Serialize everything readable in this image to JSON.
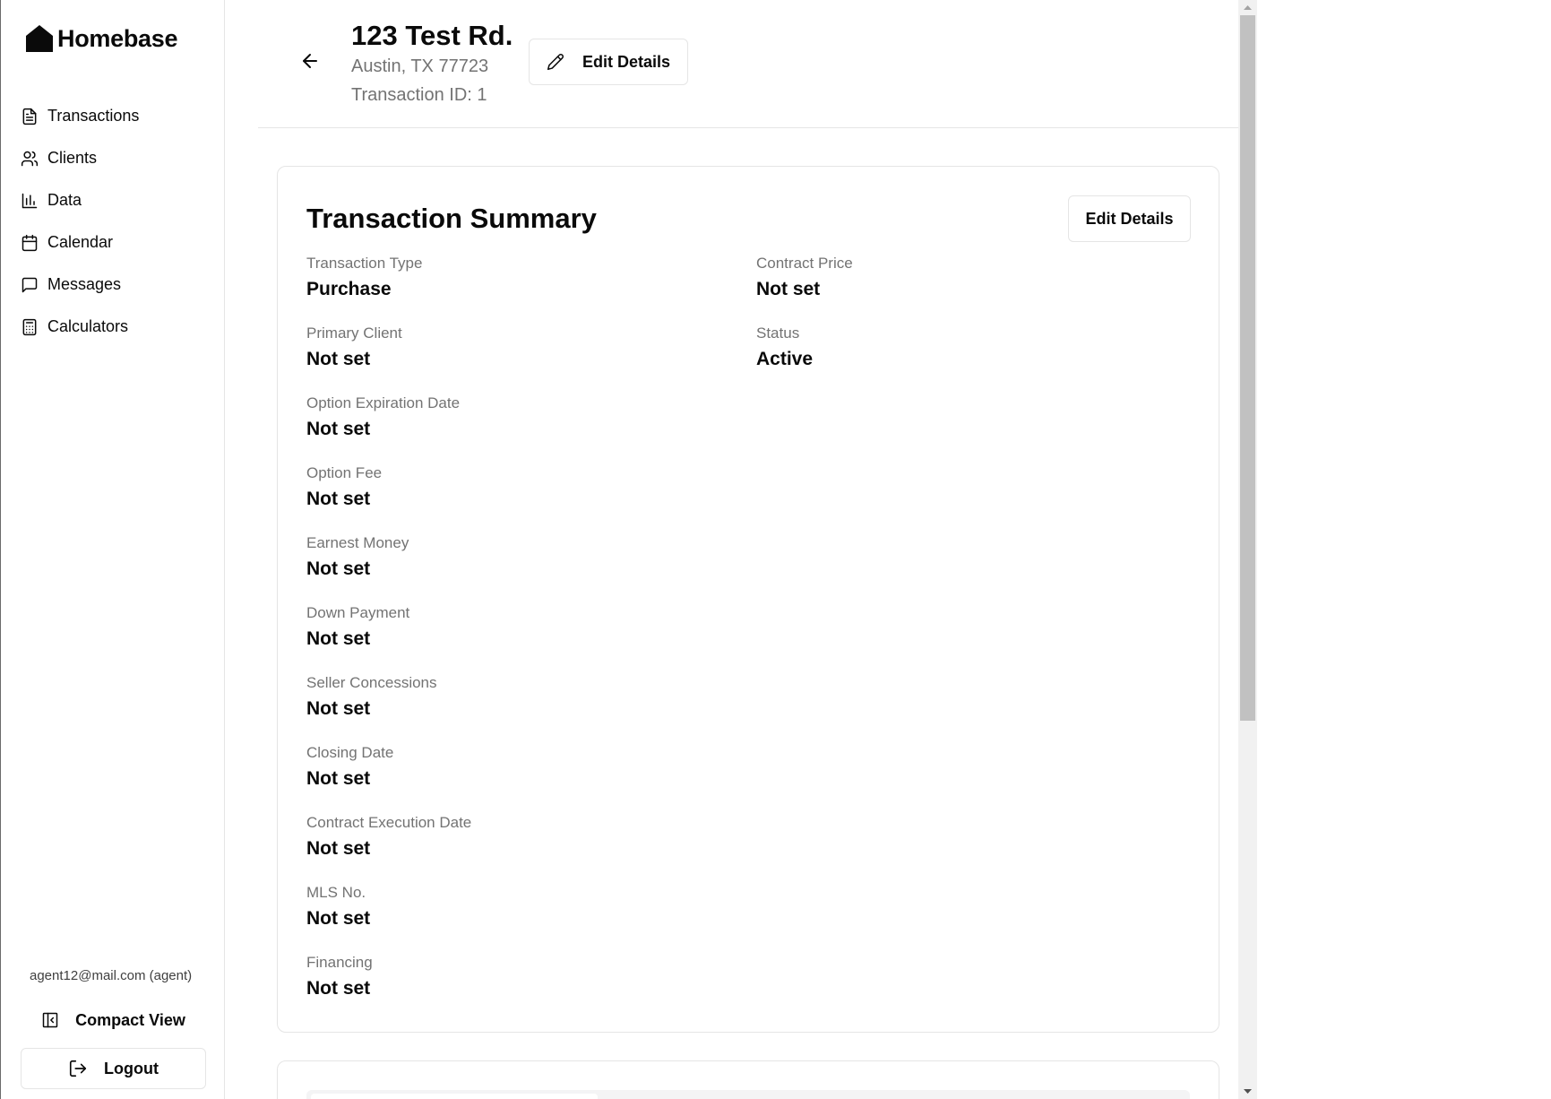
{
  "brand": {
    "name": "Homebase"
  },
  "sidebar": {
    "items": [
      {
        "label": "Transactions",
        "icon": "document-icon"
      },
      {
        "label": "Clients",
        "icon": "users-icon"
      },
      {
        "label": "Data",
        "icon": "bar-chart-icon"
      },
      {
        "label": "Calendar",
        "icon": "calendar-icon"
      },
      {
        "label": "Messages",
        "icon": "message-icon"
      },
      {
        "label": "Calculators",
        "icon": "calculator-icon"
      }
    ],
    "user_email": "agent12@mail.com (agent)",
    "compact_view_label": "Compact View",
    "logout_label": "Logout"
  },
  "header": {
    "title": "123 Test Rd.",
    "city": "Austin, TX 77723",
    "transaction_id": "Transaction ID: 1",
    "edit_label": "Edit Details"
  },
  "summary": {
    "title": "Transaction Summary",
    "edit_label": "Edit Details",
    "left_fields": [
      {
        "label": "Transaction Type",
        "value": "Purchase"
      },
      {
        "label": "Primary Client",
        "value": "Not set"
      },
      {
        "label": "Option Expiration Date",
        "value": "Not set"
      },
      {
        "label": "Option Fee",
        "value": "Not set"
      },
      {
        "label": "Earnest Money",
        "value": "Not set"
      },
      {
        "label": "Down Payment",
        "value": "Not set"
      },
      {
        "label": "Seller Concessions",
        "value": "Not set"
      },
      {
        "label": "Closing Date",
        "value": "Not set"
      },
      {
        "label": "Contract Execution Date",
        "value": "Not set"
      },
      {
        "label": "MLS No.",
        "value": "Not set"
      },
      {
        "label": "Financing",
        "value": "Not set"
      }
    ],
    "right_fields": [
      {
        "label": "Contract Price",
        "value": "Not set"
      },
      {
        "label": "Status",
        "value": "Active"
      }
    ]
  }
}
